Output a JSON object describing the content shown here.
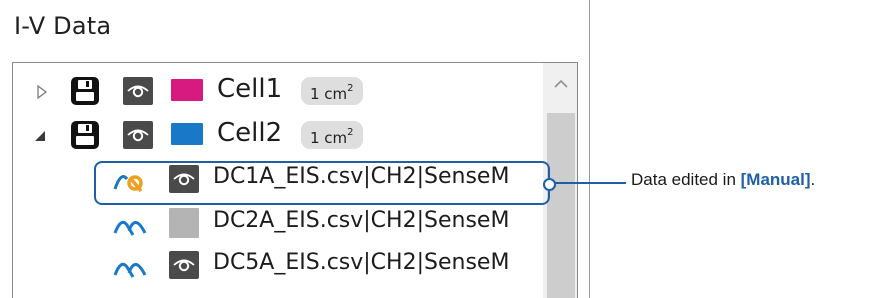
{
  "panel": {
    "title": "I-V Data"
  },
  "tree": {
    "cells": [
      {
        "name": "Cell1",
        "area": "1 cm",
        "area_sup": "2",
        "color": "#d61a7f",
        "expanded": false
      },
      {
        "name": "Cell2",
        "area": "1 cm",
        "area_sup": "2",
        "color": "#1a78c8",
        "expanded": true
      }
    ],
    "files": [
      {
        "name": "DC1A_EIS.csv|CH2|SenseM",
        "icon": "edited-waveform-icon",
        "visibility": "eye-icon"
      },
      {
        "name": "DC2A_EIS.csv|CH2|SenseM",
        "icon": "waveform-icon",
        "visibility": "hidden-gray-box"
      },
      {
        "name": "DC5A_EIS.csv|CH2|SenseM",
        "icon": "waveform-icon",
        "visibility": "eye-icon"
      }
    ]
  },
  "callout": {
    "text_prefix": "Data edited in ",
    "text_emph": "[Manual]",
    "text_suffix": "."
  },
  "colors": {
    "accent": "#1f5fa8",
    "wave_blue": "#1a78c8",
    "edit_orange": "#f0a020"
  }
}
